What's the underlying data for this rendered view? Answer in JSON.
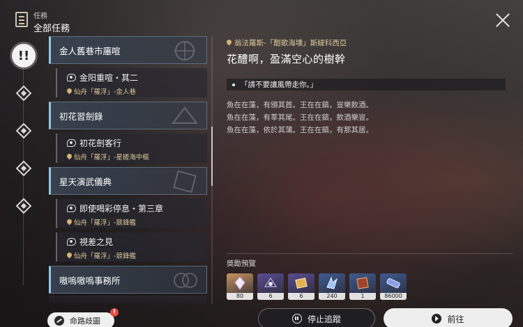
{
  "header": {
    "subtitle": "任務",
    "title": "全部任務"
  },
  "categories": [
    {
      "name": "all",
      "active": true,
      "glyph": "!!"
    },
    {
      "name": "category-2"
    },
    {
      "name": "category-3"
    },
    {
      "name": "category-4"
    },
    {
      "name": "category-5"
    }
  ],
  "quest_list": {
    "groups": [
      {
        "title": "金人舊巷市廛喧",
        "quests": [
          {
            "title": "金阳重喧・其二",
            "location": "仙舟「羅浮」-金人巷"
          }
        ]
      },
      {
        "title": "初花習劍錄",
        "quests": [
          {
            "title": "初花劍客行",
            "location": "仙舟「羅浮」-星槎海中樞"
          }
        ]
      },
      {
        "title": "星天演武儀典",
        "quests": [
          {
            "title": "即使喝彩停息・第三章",
            "location": "仙舟「羅浮」-競鋒艦"
          },
          {
            "title": "視差之見",
            "location": "仙舟「羅浮」-競鋒艦"
          }
        ]
      },
      {
        "title": "嗷嗚嗷嗚事務所",
        "quests": []
      }
    ]
  },
  "constellation_button": {
    "label": "命路歧圖",
    "badge": "!"
  },
  "detail": {
    "location": "翁法羅斯-「酣歌海壎」斯緹科西亞",
    "title": "花醴啊，盈滿空心的樹幹",
    "objective": "「請不要讓風帶走你。」",
    "description": [
      "魚在在藻，有頒其首。王在在鎬，豈樂飲酒。",
      "魚在在藻，有莘其尾。王在在鎬，飲酒樂豈。",
      "魚在在藻，依於其蒲。王在在鎬，有那其居。"
    ]
  },
  "rewards": {
    "label": "獎勵預覽",
    "items": [
      {
        "icon": "crystal-shard-icon",
        "count": "80",
        "bg": "#c9935f"
      },
      {
        "icon": "credit-chip-icon",
        "count": "6",
        "bg": "#5a4c8f"
      },
      {
        "icon": "material-box-icon",
        "count": "6",
        "bg": "#5a4c8f"
      },
      {
        "icon": "exp-material-icon",
        "count": "240",
        "bg": "#3f5a8f"
      },
      {
        "icon": "book-icon",
        "count": "1",
        "bg": "#3f5a8f"
      },
      {
        "icon": "credit-icon",
        "count": "86000",
        "bg": "#3f5a8f"
      }
    ]
  },
  "buttons": {
    "stop_tracking": "停止追蹤",
    "go": "前往"
  },
  "colors": {
    "accent": "#8fc8e8",
    "location_gold": "#d8c69a",
    "badge_red": "#e24b44"
  }
}
